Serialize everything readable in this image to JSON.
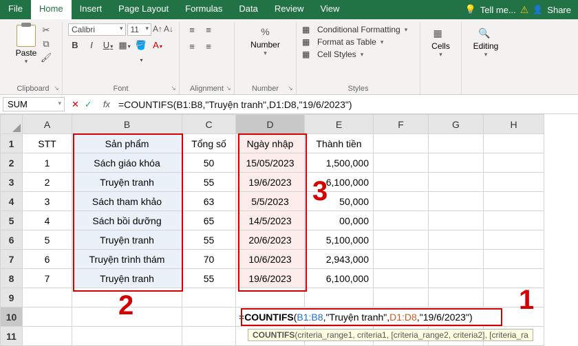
{
  "ribbon_tabs": {
    "file": "File",
    "home": "Home",
    "insert": "Insert",
    "page_layout": "Page Layout",
    "formulas": "Formulas",
    "data": "Data",
    "review": "Review",
    "view": "View",
    "tellme": "Tell me...",
    "share": "Share"
  },
  "groups": {
    "clipboard": "Clipboard",
    "font": "Font",
    "alignment": "Alignment",
    "number": "Number",
    "styles": "Styles",
    "cells": "Cells",
    "editing": "Editing"
  },
  "clipboard": {
    "paste": "Paste"
  },
  "font": {
    "name": "Calibri",
    "size": "11",
    "bold": "B",
    "italic": "I",
    "underline": "U"
  },
  "number": {
    "label": "Number"
  },
  "styles": {
    "cond": "Conditional Formatting",
    "table": "Format as Table",
    "cell": "Cell Styles"
  },
  "cells": {
    "label": "Cells"
  },
  "editing": {
    "label": "Editing"
  },
  "namebox": "SUM",
  "formula": "=COUNTIFS(B1:B8,\"Truyện tranh\",D1:D8,\"19/6/2023\")",
  "columns": [
    "A",
    "B",
    "C",
    "D",
    "E",
    "F",
    "G",
    "H"
  ],
  "headers": {
    "A": "STT",
    "B": "Sản phẩm",
    "C": "Tổng số",
    "D": "Ngày nhập",
    "E": "Thành tiền"
  },
  "rows": [
    {
      "n": "1",
      "A": "1",
      "B": "Sách giáo khóa",
      "C": "50",
      "D": "15/05/2023",
      "E": "1,500,000"
    },
    {
      "n": "2",
      "A": "2",
      "B": "Truyện tranh",
      "C": "55",
      "D": "19/6/2023",
      "E": "6,100,000"
    },
    {
      "n": "3",
      "A": "3",
      "B": "Sách tham khảo",
      "C": "63",
      "D": "5/5/2023",
      "E": "  50,000"
    },
    {
      "n": "4",
      "A": "4",
      "B": "Sách bồi dưỡng",
      "C": "65",
      "D": "14/5/2023",
      "E": "  00,000"
    },
    {
      "n": "5",
      "A": "5",
      "B": "Truyện tranh",
      "C": "55",
      "D": "20/6/2023",
      "E": "5,100,000"
    },
    {
      "n": "6",
      "A": "6",
      "B": "Truyện trình thám",
      "C": "70",
      "D": "10/6/2023",
      "E": "2,943,000"
    },
    {
      "n": "7",
      "A": "7",
      "B": "Truyện tranh",
      "C": "55",
      "D": "19/6/2023",
      "E": "6,100,000"
    }
  ],
  "formula_inline": {
    "fn": "COUNTIFS",
    "r1": "B1:B8",
    "s1": "\"Truyện tranh\"",
    "r2": "D1:D8",
    "s2": "\"19/6/2023\""
  },
  "annotations": {
    "a1": "1",
    "a2": "2",
    "a3": "3"
  },
  "tooltip_left": "COUNTIFS",
  "tooltip_right": "(criteria_range1, criteria1, [criteria_range2, criteria2], [criteria_ra"
}
